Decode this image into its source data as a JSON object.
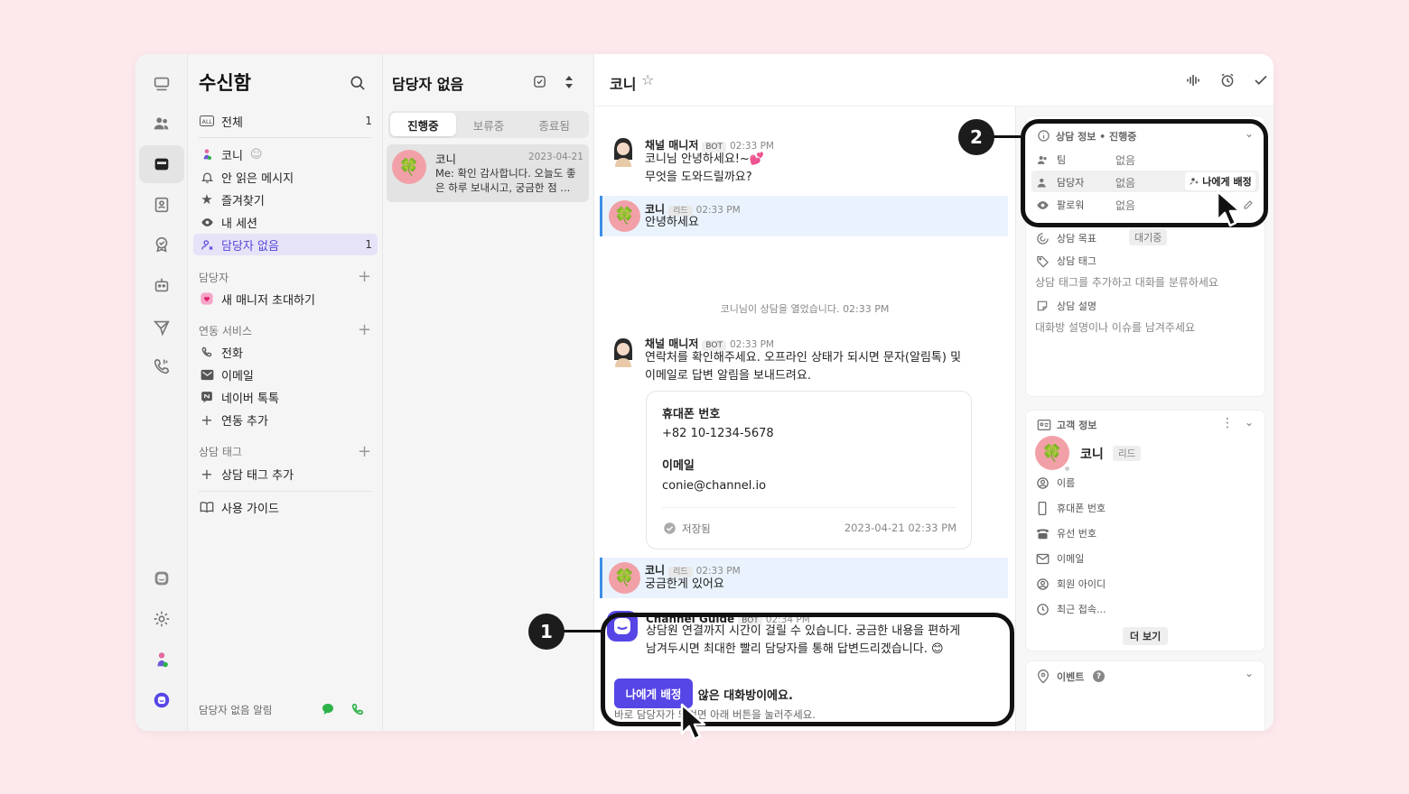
{
  "sidebar": {
    "title": "수신함",
    "items": [
      {
        "label": "전체",
        "count": "1"
      },
      {
        "label": "코니"
      },
      {
        "label": "안 읽은 메시지"
      },
      {
        "label": "즐겨찾기"
      },
      {
        "label": "내 세션"
      },
      {
        "label": "담당자 없음",
        "count": "1"
      }
    ],
    "assignee_header": "담당자",
    "invite_manager": "새 매니저 초대하기",
    "integration_header": "연동 서비스",
    "integrations": [
      "전화",
      "이메일",
      "네이버 톡톡",
      "연동 추가"
    ],
    "tag_header": "상담 태그",
    "add_tag": "상담 태그 추가",
    "guide": "사용 가이드",
    "footer_label": "담당자 없음 알림"
  },
  "list": {
    "title": "담당자 없음",
    "tabs": [
      "진행중",
      "보류중",
      "종료됨"
    ],
    "conversation": {
      "name": "코니",
      "date": "2023-04-21",
      "preview": "Me: 확인 감사합니다. 오늘도 좋은 하루 보내시고, 궁금한 점 ..."
    }
  },
  "chat": {
    "title": "코니",
    "messages": {
      "m1": {
        "name": "채널 매니저",
        "tag": "BOT",
        "time": "02:33 PM",
        "line1": "코니님 안녕하세요!~💕",
        "line2": "무엇을 도와드릴까요?"
      },
      "m2": {
        "name": "코니",
        "tag": "리드",
        "time": "02:33 PM",
        "text": "안녕하세요"
      },
      "system": {
        "name": "코니",
        "text": "님이 상담을 열었습니다.",
        "time": "02:33 PM"
      },
      "m3": {
        "name": "채널 매니저",
        "tag": "BOT",
        "time": "02:33 PM",
        "line1": "연락처를 확인해주세요. 오프라인 상태가 되시면 문자(알림톡) 및",
        "line2": "이메일로 답변 알림을 보내드려요."
      },
      "form": {
        "phone_label": "휴대폰 번호",
        "phone_value": "+82 10-1234-5678",
        "email_label": "이메일",
        "email_value": "conie@channel.io",
        "saved": "저장됨",
        "saved_time": "2023-04-21 02:33 PM"
      },
      "m4": {
        "name": "코니",
        "tag": "리드",
        "time": "02:33 PM",
        "text": "궁금한게 있어요"
      },
      "m5": {
        "name": "Channel Guide",
        "tag": "BOT",
        "time": "02:34 PM",
        "line1": "상담원 연결까지 시간이 걸릴 수 있습니다. 궁금한 내용을 편하게",
        "line2": "남겨두시면 최대한 빨리 담당자를 통해 답변드리겠습니다. 😊"
      }
    },
    "unassigned": {
      "title": "아무도 담당하지 않은 대화방이에요.",
      "desc": "바로 담당자가 되려면 아래 버튼을 눌러주세요.",
      "button": "나에게 배정"
    }
  },
  "right": {
    "info_title": "상담 정보 • 진행중",
    "team_label": "팀",
    "team_value": "없음",
    "assignee_label": "담당자",
    "assignee_value": "없음",
    "assign_me": "나에게 배정",
    "follower_label": "팔로워",
    "follower_value": "없음",
    "goal_label": "상담 목표",
    "goal_value": "대기중",
    "tag_label": "상담 태그",
    "tag_placeholder": "상담 태그를 추가하고 대화를 분류하세요",
    "desc_label": "상담 설명",
    "desc_placeholder": "대화방 설명이나 이슈를 남겨주세요",
    "customer_title": "고객 정보",
    "customer_name": "코니",
    "customer_tag": "리드",
    "fields": [
      "이름",
      "휴대폰 번호",
      "유선 번호",
      "이메일",
      "회원 아이디",
      "최근 접속..."
    ],
    "more": "더 보기",
    "event_title": "이벤트"
  },
  "callouts": [
    "1",
    "2"
  ],
  "colors": {
    "accent": "#5646e6",
    "selected_bg": "#e6e3f8",
    "highlight_bar": "#3d8ee6",
    "callout": "#111111"
  }
}
